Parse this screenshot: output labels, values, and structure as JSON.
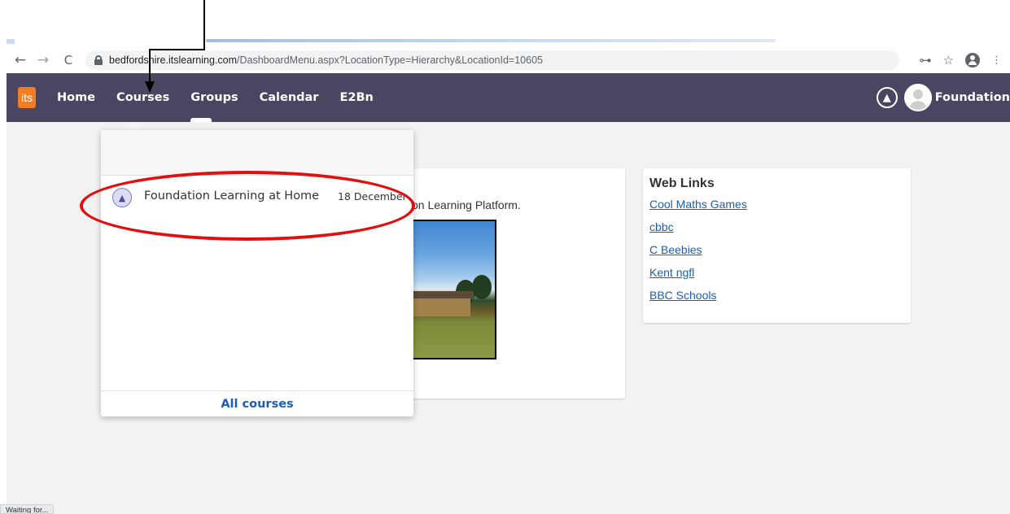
{
  "browser": {
    "url_host": "bedfordshire.itslearning.com",
    "url_path": "/DashboardMenu.aspx?LocationType=Hierarchy&LocationId=10605",
    "back_glyph": "←",
    "forward_glyph": "→",
    "reload_glyph": "C",
    "key_glyph": "⊶",
    "star_glyph": "☆",
    "menu_glyph": "⋮",
    "status_text": "Waiting for..."
  },
  "site_nav": {
    "logo_text": "its",
    "items": [
      {
        "label": "Home"
      },
      {
        "label": "Courses"
      },
      {
        "label": "Groups"
      },
      {
        "label": "Calendar"
      },
      {
        "label": "E2Bn"
      }
    ],
    "bell_glyph": "🔔",
    "user_name": "Foundation"
  },
  "courses_dropdown": {
    "items": [
      {
        "name": "Foundation Learning at Home",
        "date": "18 December",
        "icon_glyph": "🎓"
      }
    ],
    "footer_label": "All courses"
  },
  "welcome_card": {
    "text": "on Learning Platform."
  },
  "web_links": {
    "title": "Web Links",
    "links": [
      {
        "label": "Cool Maths Games"
      },
      {
        "label": "cbbc"
      },
      {
        "label": "C Beebies"
      },
      {
        "label": "Kent ngfl"
      },
      {
        "label": "BBC Schools"
      }
    ]
  },
  "colors": {
    "nav_bg": "#4a4561",
    "logo_orange": "#f27c21",
    "link_blue": "#1a5fb4",
    "annotation_red": "#e01010",
    "page_bg": "#f2f2f2"
  }
}
